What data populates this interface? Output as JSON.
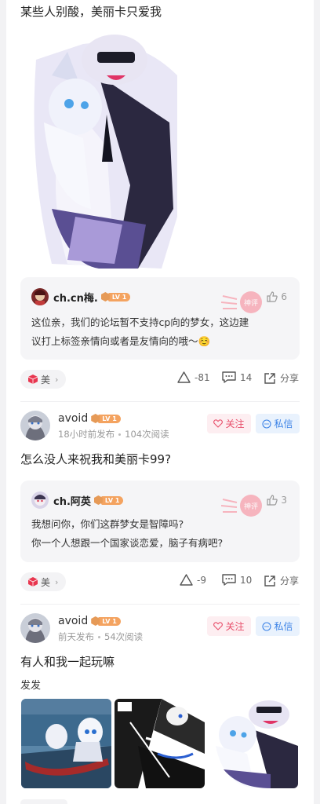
{
  "posts": [
    {
      "title": "某些人别酸，美丽卡只爱我",
      "comment": {
        "user": "ch.cn梅.",
        "level": "LV 1",
        "likes": "6",
        "lines": [
          "这位亲，我们的论坛暂不支持cp向的梦女，这边建",
          "议打上标签亲情向或者是友情向的哦～☺️"
        ]
      },
      "tag": "美",
      "actions": {
        "votes": "-81",
        "comments": "14",
        "share": "分享"
      }
    },
    {
      "author": "avoid",
      "level": "LV 1",
      "time": "18小时前发布",
      "views": "104次阅读",
      "follow": "关注",
      "message": "私信",
      "title": "怎么没人来祝我和美丽卡99?",
      "comment": {
        "user": "ch.阿英",
        "level": "LV 1",
        "likes": "3",
        "lines": [
          "我想问你，你们这群梦女是智障吗?",
          "你一个人想跟一个国家谈恋爱，脑子有病吧?"
        ]
      },
      "tag": "美",
      "actions": {
        "votes": "-9",
        "comments": "10",
        "share": "分享"
      }
    },
    {
      "author": "avoid",
      "level": "LV 1",
      "time": "前天发布",
      "views": "54次阅读",
      "follow": "关注",
      "message": "私信",
      "title": "有人和我一起玩嘛",
      "body": "发发"
    }
  ],
  "stamp_text": "神评",
  "colors": {
    "follow": "#e8506c",
    "message": "#3b82e6",
    "level": "#f4a360",
    "tag": "#e8364f"
  },
  "icons": [
    "thumb-up-icon",
    "delta-vote-icon",
    "comment-icon",
    "share-icon",
    "heart-icon",
    "chat-bubble-icon",
    "cube-tag-icon",
    "chevron-right-icon"
  ]
}
